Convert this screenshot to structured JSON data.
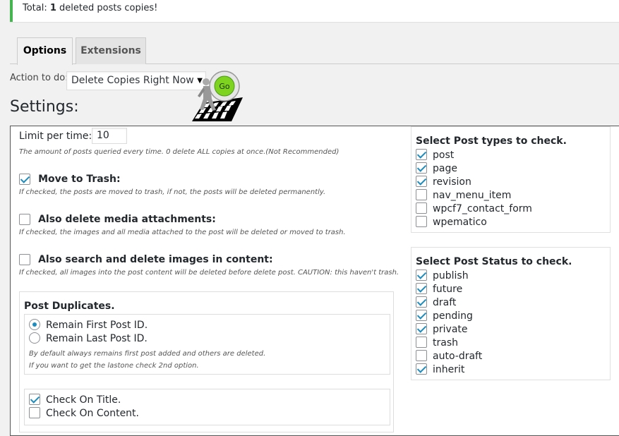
{
  "notice": {
    "prefix": "Total: ",
    "count": "1",
    "suffix": " deleted posts copies!"
  },
  "tabs": [
    {
      "label": "Options",
      "active": true
    },
    {
      "label": "Extensions",
      "active": false
    }
  ],
  "action": {
    "label": "Action to do:",
    "selected": "Delete Copies Right Now",
    "go_label": "Go"
  },
  "settings_title": "Settings:",
  "limit": {
    "label": "Limit per time:",
    "value": "10",
    "desc": "The amount of posts queried every time. 0 delete ALL copies at once.(Not Recommended)"
  },
  "move_trash": {
    "label": "Move to Trash:",
    "checked": true,
    "desc": "If checked, the posts are moved to trash, if not, the posts will be deleted permanently."
  },
  "media": {
    "label": "Also delete media attachments:",
    "checked": false,
    "desc": "If checked, the images and all media attached to the post will be deleted or moved to trash."
  },
  "content_images": {
    "label": "Also search and delete images in content:",
    "checked": false,
    "desc": "If checked, all images into the post content will be deleted before delete post. CAUTION: this haven't trash."
  },
  "duplicates": {
    "title": "Post Duplicates.",
    "options": [
      {
        "label": "Remain First Post ID.",
        "checked": true
      },
      {
        "label": "Remain Last Post ID.",
        "checked": false
      }
    ],
    "desc1": "By default always remains first post added and others are deleted.",
    "desc2": "If you want to get the lastone check 2nd option.",
    "checks": [
      {
        "label": "Check On Title.",
        "checked": true
      },
      {
        "label": "Check On Content.",
        "checked": false
      }
    ]
  },
  "post_types": {
    "title": "Select Post types to check.",
    "items": [
      {
        "label": "post",
        "checked": true
      },
      {
        "label": "page",
        "checked": true
      },
      {
        "label": "revision",
        "checked": true
      },
      {
        "label": "nav_menu_item",
        "checked": false
      },
      {
        "label": "wpcf7_contact_form",
        "checked": false
      },
      {
        "label": "wpematico",
        "checked": false
      }
    ]
  },
  "post_status": {
    "title": "Select Post Status to check.",
    "items": [
      {
        "label": "publish",
        "checked": true
      },
      {
        "label": "future",
        "checked": true
      },
      {
        "label": "draft",
        "checked": true
      },
      {
        "label": "pending",
        "checked": true
      },
      {
        "label": "private",
        "checked": true
      },
      {
        "label": "trash",
        "checked": false
      },
      {
        "label": "auto-draft",
        "checked": false
      },
      {
        "label": "inherit",
        "checked": true
      }
    ]
  },
  "colors": {
    "accent": "#1e8cbe",
    "notice_border": "#46b450",
    "go_green": "#7ed321"
  }
}
